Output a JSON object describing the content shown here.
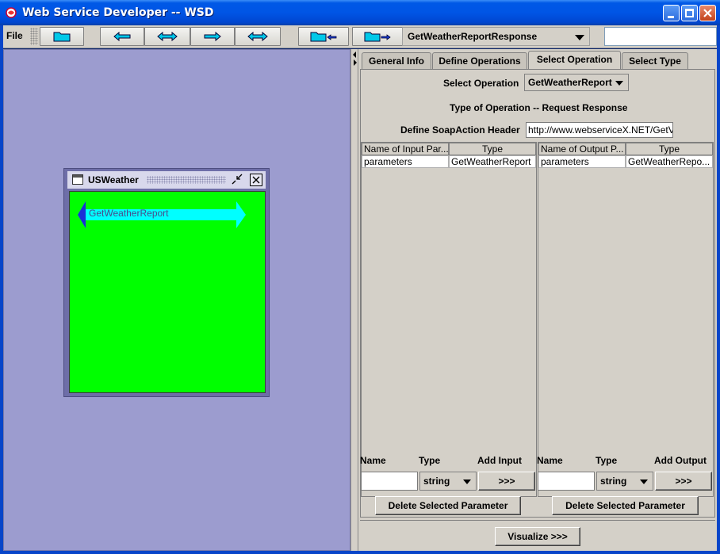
{
  "window": {
    "title": "Web Service Developer -- WSD",
    "controls": {
      "minimize": "minimize",
      "maximize": "maximize",
      "close": "close"
    }
  },
  "toolbar": {
    "file_menu": "File",
    "buttons": [
      {
        "icon": "folder-open-icon"
      },
      {
        "icon": "arrow-left-icon"
      },
      {
        "icon": "arrow-left-right-icon"
      },
      {
        "icon": "arrow-right-icon"
      },
      {
        "icon": "arrow-left-right-icon"
      },
      {
        "icon": "folder-arrow-left-icon"
      },
      {
        "icon": "folder-arrow-right-icon"
      }
    ],
    "operation_select": "GetWeatherReportResponse",
    "search_value": ""
  },
  "canvas": {
    "frame_title": "USWeather",
    "operation_label": "GetWeatherReport",
    "content_color": "#00ff00",
    "arrow_color": "#00ffff"
  },
  "tabs": [
    {
      "label": "General Info",
      "active": false
    },
    {
      "label": "Define Operations",
      "active": false
    },
    {
      "label": "Select Operation",
      "active": true
    },
    {
      "label": "Select Type",
      "active": false
    }
  ],
  "panel": {
    "select_operation_label": "Select Operation",
    "select_operation_value": "GetWeatherReport",
    "operation_type": "Type of Operation -- Request Response",
    "soap_action_label": "Define SoapAction Header",
    "soap_action_value": "http://www.webserviceX.NET/GetV",
    "input_table": {
      "headers": [
        "Name of Input Par...",
        "Type"
      ],
      "rows": [
        [
          "parameters",
          "GetWeatherReport"
        ]
      ]
    },
    "output_table": {
      "headers": [
        "Name of Output P...",
        "Type"
      ],
      "rows": [
        [
          "parameters",
          "GetWeatherRepo..."
        ]
      ]
    },
    "input_add": {
      "name_label": "Name",
      "type_label": "Type",
      "add_label": "Add Input",
      "name_value": "",
      "type_value": "string",
      "add_button": ">>>"
    },
    "output_add": {
      "name_label": "Name",
      "type_label": "Type",
      "add_label": "Add Output",
      "name_value": "",
      "type_value": "string",
      "add_button": ">>>"
    },
    "delete_input_button": "Delete Selected Parameter",
    "delete_output_button": "Delete Selected Parameter",
    "visualize_button": "Visualize >>>"
  }
}
